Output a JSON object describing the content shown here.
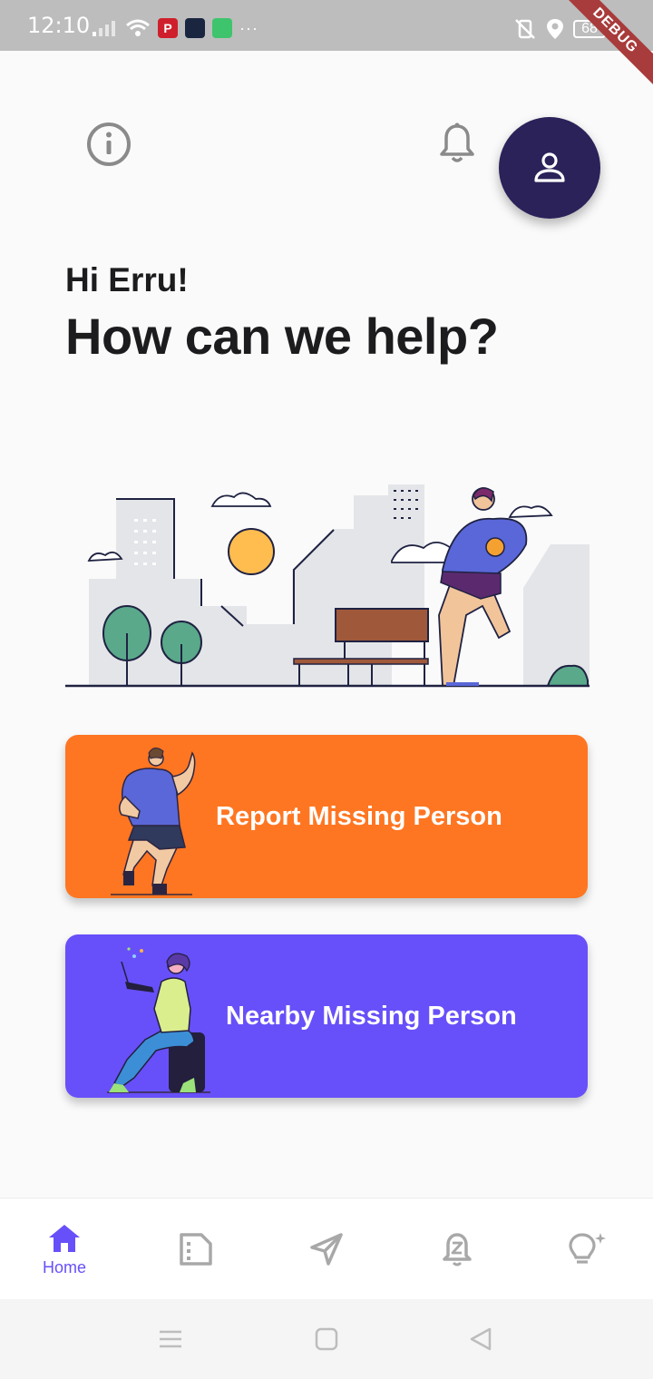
{
  "status_bar": {
    "time": "12:10",
    "battery": "68",
    "debug_label": "DEBUG",
    "notification_icons": [
      "pinterest-icon",
      "news-app-icon",
      "messages-icon",
      "more-dots-icon"
    ],
    "system_icons": [
      "mute-vibrate-icon",
      "location-icon",
      "battery-icon",
      "charging-icon"
    ]
  },
  "header": {
    "greeting": "Hi Erru!",
    "headline": "How can we help?"
  },
  "top_actions": {
    "info_icon": "info-icon",
    "bell_icon": "bell-icon",
    "profile_icon": "person-icon"
  },
  "cards": [
    {
      "label": "Report Missing Person",
      "color": "#ff7622",
      "illustration": "man-pointing-illustration"
    },
    {
      "label": "Nearby Missing Person",
      "color": "#6750f9",
      "illustration": "woman-with-laptop-illustration"
    }
  ],
  "bottom_nav": {
    "items": [
      {
        "label": "Home",
        "icon": "home-icon",
        "active": true
      },
      {
        "label": "",
        "icon": "report-document-icon",
        "active": false
      },
      {
        "label": "",
        "icon": "send-navigation-icon",
        "active": false
      },
      {
        "label": "",
        "icon": "sleep-alarm-bell-icon",
        "active": false
      },
      {
        "label": "",
        "icon": "idea-bulb-icon",
        "active": false
      }
    ]
  },
  "colors": {
    "accent": "#6750f9",
    "orange": "#ff7622",
    "profile": "#2a2259",
    "inactive_icon": "#a8a8a8"
  }
}
